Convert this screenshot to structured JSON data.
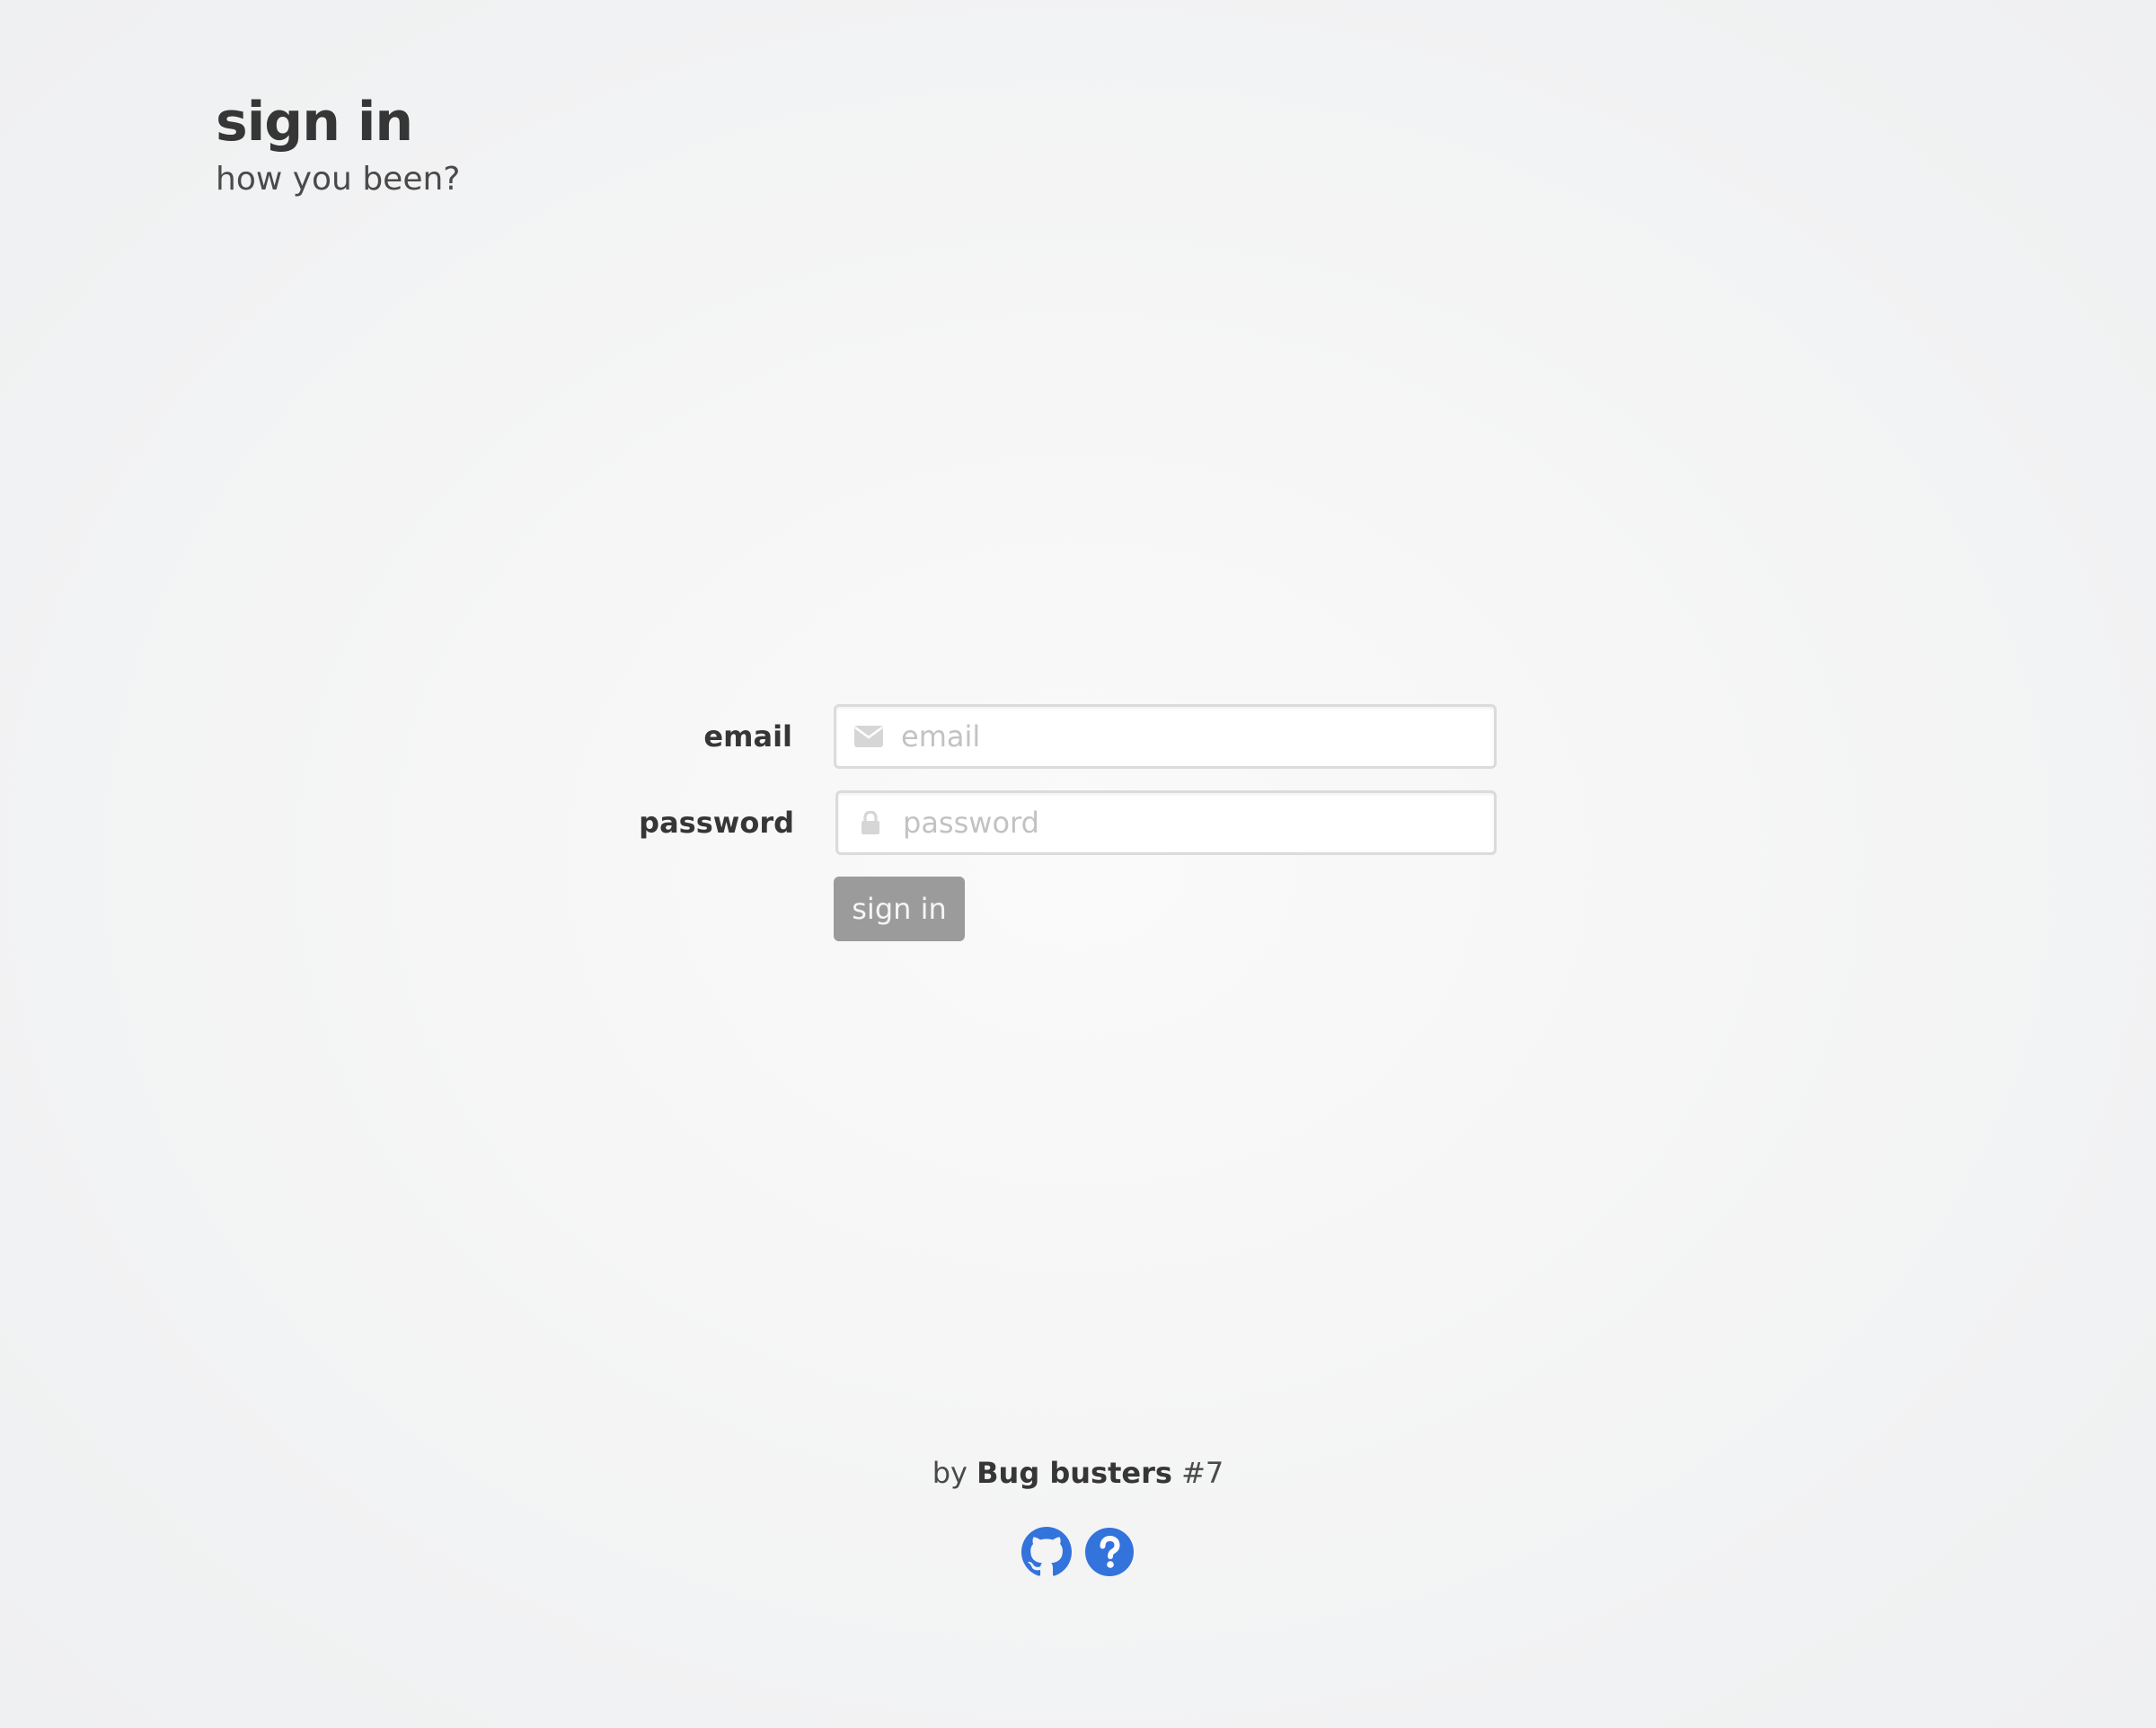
{
  "header": {
    "title": "sign in",
    "subtitle": "how you been?"
  },
  "form": {
    "email": {
      "label": "email",
      "placeholder": "email",
      "value": "",
      "icon": "envelope-icon"
    },
    "password": {
      "label": "password",
      "placeholder": "password",
      "value": "",
      "icon": "lock-icon"
    },
    "submit_label": "sign in",
    "submit_enabled": false
  },
  "footer": {
    "credit_prefix": "by",
    "team_name": "Bug busters",
    "team_number": "#7",
    "links": [
      {
        "icon": "github-icon"
      },
      {
        "icon": "help-icon"
      }
    ]
  },
  "colors": {
    "accent": "#3273dc",
    "button_disabled": "#9b9b9b",
    "text": "#363636"
  }
}
